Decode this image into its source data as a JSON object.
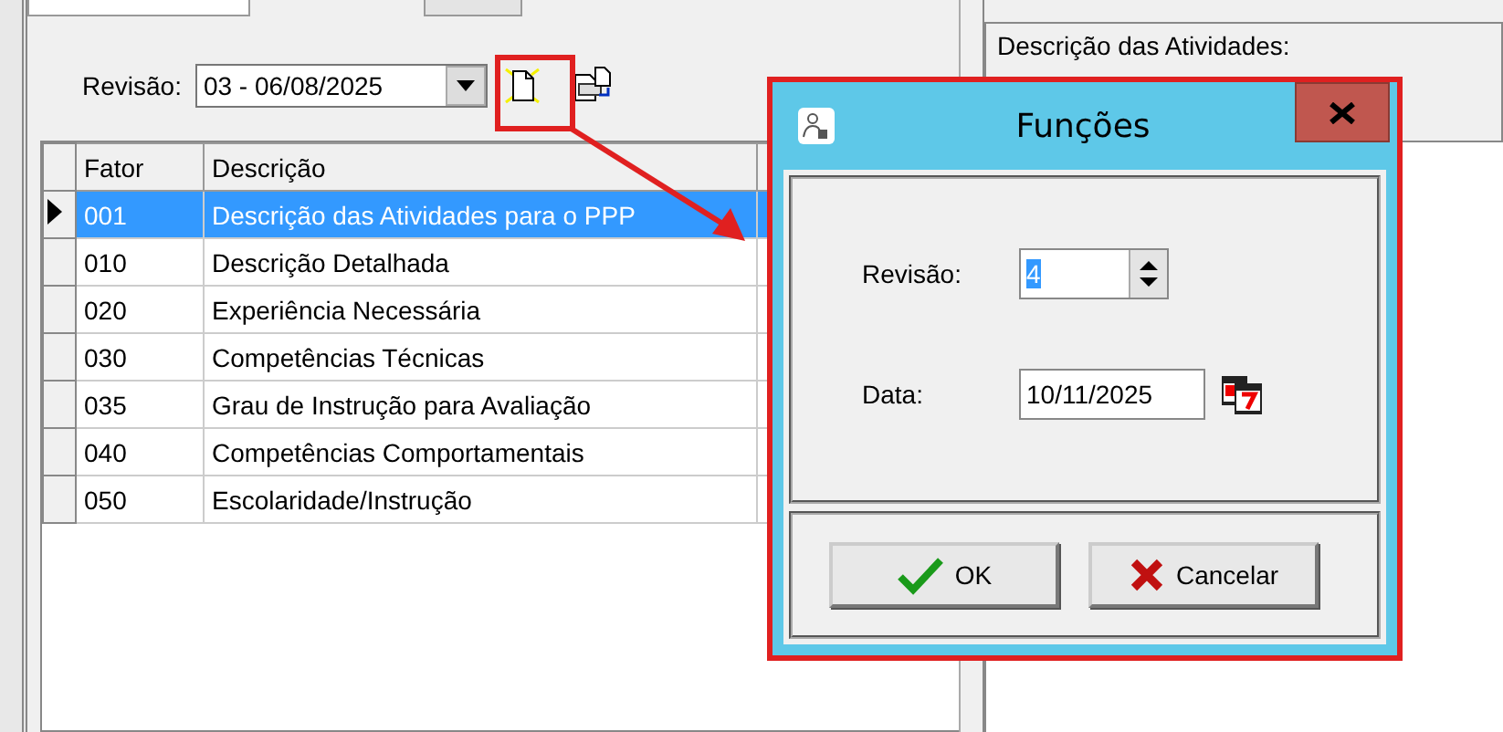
{
  "tabs": [
    {
      "selected": true
    },
    {
      "selected": false
    }
  ],
  "revision_filter": {
    "label": "Revisão:",
    "value": "03 - 06/08/2025"
  },
  "grid": {
    "columns": [
      "Fator",
      "Descrição"
    ],
    "rows": [
      {
        "fator": "001",
        "descricao": "Descrição das Atividades para o PPP",
        "selected": true
      },
      {
        "fator": "010",
        "descricao": "Descrição Detalhada",
        "selected": false
      },
      {
        "fator": "020",
        "descricao": "Experiência Necessária",
        "selected": false
      },
      {
        "fator": "030",
        "descricao": "Competências Técnicas",
        "selected": false
      },
      {
        "fator": "035",
        "descricao": "Grau de Instrução para Avaliação",
        "selected": false
      },
      {
        "fator": "040",
        "descricao": "Competências Comportamentais",
        "selected": false
      },
      {
        "fator": "050",
        "descricao": "Escolaridade/Instrução",
        "selected": false
      }
    ]
  },
  "memo": {
    "text": "Descrição das Atividades:"
  },
  "dialog": {
    "title": "Funções",
    "fields": [
      {
        "kind": "spin",
        "label": "Revisão:",
        "value": "4"
      },
      {
        "kind": "date",
        "label": "Data:",
        "value": "10/11/2025"
      }
    ],
    "buttons": [
      {
        "kind": "ok",
        "label": "OK"
      },
      {
        "kind": "cancel",
        "label": "Cancelar"
      }
    ]
  }
}
